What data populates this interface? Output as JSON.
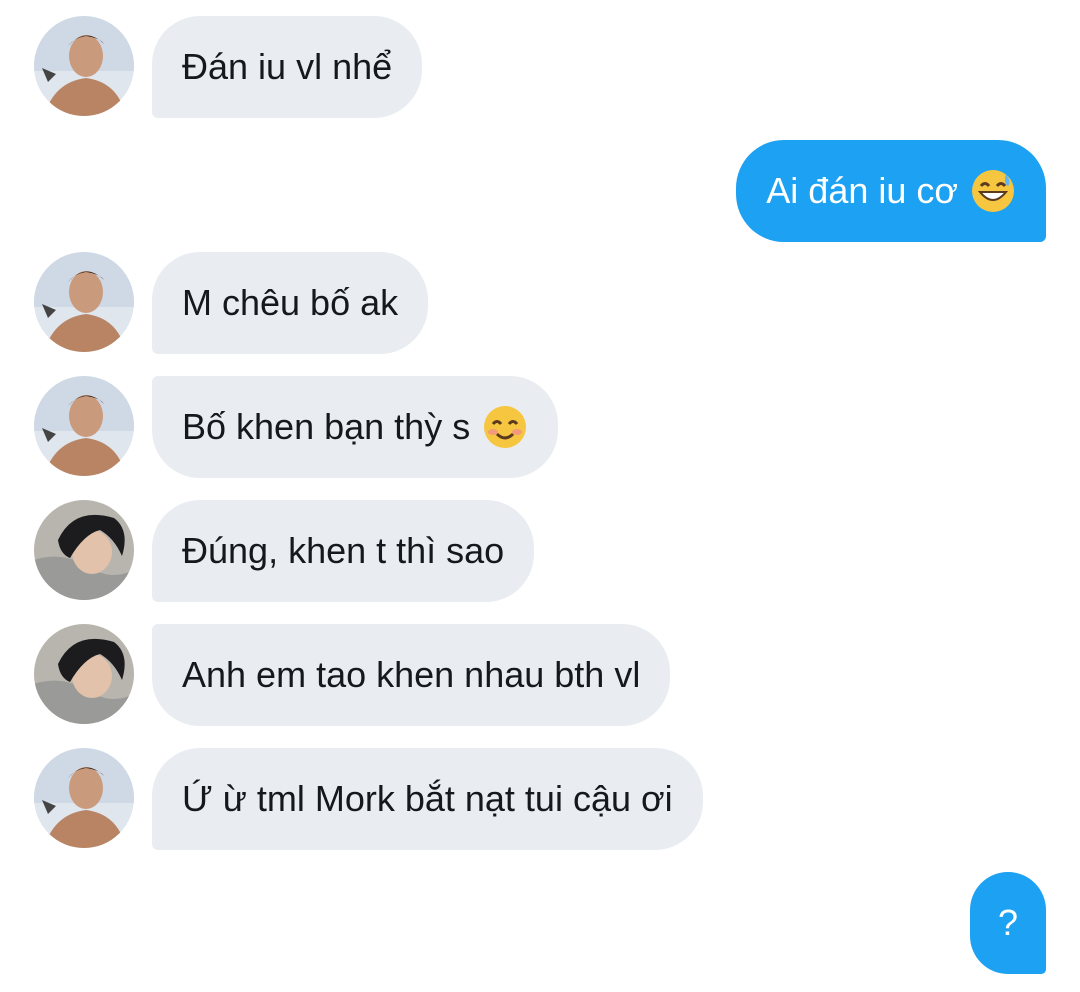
{
  "messages": [
    {
      "text": "Đán iu vl nhể",
      "sender": "friend-a",
      "avatar": "avatar-shirtless-boy"
    },
    {
      "text": "Ai đán iu cơ",
      "sender": "me",
      "emoji": "grinning-sweat-emoji"
    },
    {
      "text": "M chêu bố ak",
      "sender": "friend-a",
      "avatar": "avatar-shirtless-boy"
    },
    {
      "text": "Bố khen bạn thỳ s",
      "sender": "friend-a",
      "avatar": "avatar-shirtless-boy",
      "emoji": "smiling-blush-emoji"
    },
    {
      "text": "Đúng, khen t thì sao",
      "sender": "friend-b",
      "avatar": "avatar-dark-hair-boy"
    },
    {
      "text": "Anh em tao khen nhau bth vl",
      "sender": "friend-b",
      "avatar": "avatar-dark-hair-boy"
    },
    {
      "text": "Ứ ừ tml Mork bắt nạt tui cậu ơi",
      "sender": "friend-a",
      "avatar": "avatar-shirtless-boy"
    },
    {
      "text": "?",
      "sender": "me"
    }
  ],
  "colors": {
    "incoming_bubble": "#e9edf1",
    "outgoing_bubble": "#1da1f2",
    "incoming_text": "#15191d",
    "outgoing_text": "#ffffff"
  }
}
